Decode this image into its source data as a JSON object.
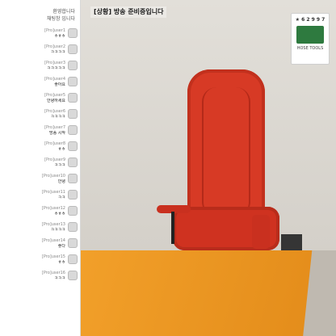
{
  "chat": {
    "header_line1": "환영합니다",
    "header_line2": "채팅창 입니다",
    "messages": [
      {
        "user": "[Pro]user1",
        "text": "ㅎㅎㅎ"
      },
      {
        "user": "[Pro]user2",
        "text": "ㅋㅋㅋㅋ"
      },
      {
        "user": "[Pro]user3",
        "text": "ㅋㅋㅋㅋㅋ"
      },
      {
        "user": "[Pro]user4",
        "text": "좋아요"
      },
      {
        "user": "[Pro]user5",
        "text": "안녕하세요"
      },
      {
        "user": "[Pro]user6",
        "text": "ㅋㅋㅋㅋ"
      },
      {
        "user": "[Pro]user7",
        "text": "방송 시작"
      },
      {
        "user": "[Pro]user8",
        "text": "ㅎㅎ"
      },
      {
        "user": "[Pro]user9",
        "text": "ㅋㅋㅋ"
      },
      {
        "user": "[Pro]user10",
        "text": "안녕"
      },
      {
        "user": "[Pro]user11",
        "text": "ㅋㅋ"
      },
      {
        "user": "[Pro]user12",
        "text": "ㅎㅎㅎ"
      },
      {
        "user": "[Pro]user13",
        "text": "ㅋㅋㅋㅋ"
      },
      {
        "user": "[Pro]user14",
        "text": "좋다"
      },
      {
        "user": "[Pro]user15",
        "text": "ㅎㅎ"
      },
      {
        "user": "[Pro]user16",
        "text": "ㅋㅋㅋ"
      }
    ]
  },
  "stream": {
    "title": "[상황] 방송 준비중입니다",
    "logo_top": "★ 6 2 9 9 7",
    "logo_bottom": "HOSE TOOLS"
  }
}
